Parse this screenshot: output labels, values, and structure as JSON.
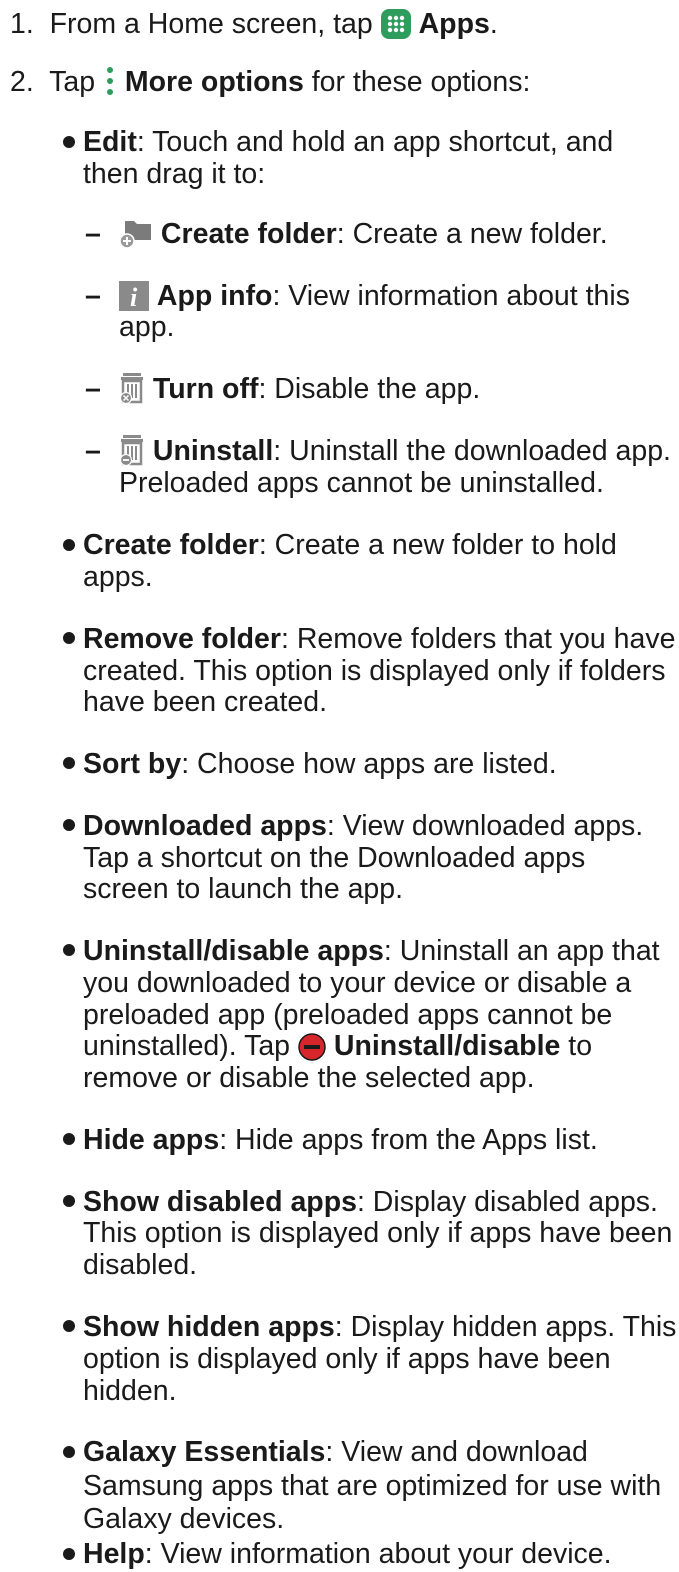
{
  "steps": [
    {
      "num": "1.",
      "pre": "From a Home screen, tap",
      "bold": "Apps",
      "post": ".",
      "icon": "apps-grid-icon"
    },
    {
      "num": "2.",
      "pre": "Tap",
      "bold": "More options",
      "post": " for these options:",
      "icon": "more-options-icon"
    }
  ],
  "edit": {
    "term": "Edit",
    "desc_line1": ": Touch and hold an app shortcut, and",
    "desc_line2": "then drag it to:",
    "subitems": [
      {
        "icon": "create-folder-icon",
        "term": "Create folder",
        "line1": ": Create a new folder."
      },
      {
        "icon": "app-info-icon",
        "term": "App info",
        "line1": ": View information about this",
        "line2": "app."
      },
      {
        "icon": "turn-off-icon",
        "term": "Turn off",
        "line1": ": Disable the app."
      },
      {
        "icon": "uninstall-icon",
        "term": "Uninstall",
        "line1": ": Uninstall the downloaded app.",
        "line2": "Preloaded apps cannot be uninstalled."
      }
    ]
  },
  "options": [
    {
      "term": "Create folder",
      "lines": [
        ": Create a new folder to hold",
        "apps."
      ]
    },
    {
      "term": "Remove folder",
      "lines": [
        ": Remove folders that you have",
        "created. This option is displayed only if folders",
        "have been created."
      ]
    },
    {
      "term": "Sort by",
      "lines": [
        ": Choose how apps are listed."
      ]
    },
    {
      "term": "Downloaded apps",
      "lines": [
        ": View downloaded apps.",
        "Tap a shortcut on the Downloaded apps",
        "screen to launch the app."
      ]
    },
    {
      "term": "Uninstall/disable apps",
      "lines": [
        ": Uninstall an app that",
        "you downloaded to your device or disable a",
        "preloaded app (preloaded apps cannot be"
      ]
    },
    {
      "term": "Hide apps",
      "lines": [
        ": Hide apps from the Apps list."
      ]
    },
    {
      "term": "Show disabled apps",
      "lines": [
        ": Display disabled apps.",
        "This option is displayed only if apps have been",
        "disabled."
      ]
    },
    {
      "term": "Show hidden apps",
      "lines": [
        ": Display hidden apps. This",
        "option is displayed only if apps have been",
        "hidden."
      ]
    },
    {
      "term": "Galaxy Essentials",
      "lines": [
        ": View and download",
        "Samsung apps that are optimized for use with",
        "Galaxy devices."
      ]
    },
    {
      "term": "Help",
      "lines": [
        ": View information about your device."
      ]
    }
  ],
  "uninstall_extra": {
    "pre": "uninstalled). Tap",
    "bold": "Uninstall/disable",
    "post": " to",
    "line": "remove or disable the selected app.",
    "icon": "minus-circle-icon"
  },
  "colors": {
    "text": "#1a1a1a",
    "icon_green": "#2e9d5b",
    "icon_gray": "#8a8a8a",
    "minus_red": "#d6262c"
  }
}
